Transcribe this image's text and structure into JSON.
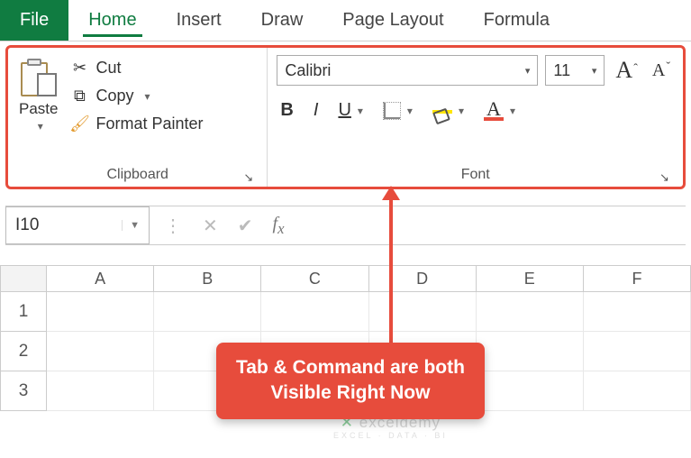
{
  "tabs": {
    "file": "File",
    "home": "Home",
    "insert": "Insert",
    "draw": "Draw",
    "page_layout": "Page Layout",
    "formula": "Formula"
  },
  "ribbon": {
    "clipboard": {
      "label": "Clipboard",
      "paste": "Paste",
      "cut": "Cut",
      "copy": "Copy",
      "format_painter": "Format Painter"
    },
    "font": {
      "label": "Font",
      "name": "Calibri",
      "size": "11"
    }
  },
  "namebox": "I10",
  "columns": [
    "A",
    "B",
    "C",
    "D",
    "E",
    "F"
  ],
  "rows": [
    "1",
    "2",
    "3"
  ],
  "callout": {
    "line1": "Tab & Command are both",
    "line2": "Visible Right Now"
  },
  "watermark": {
    "main": "exceldemy",
    "sub": "EXCEL · DATA · BI"
  }
}
